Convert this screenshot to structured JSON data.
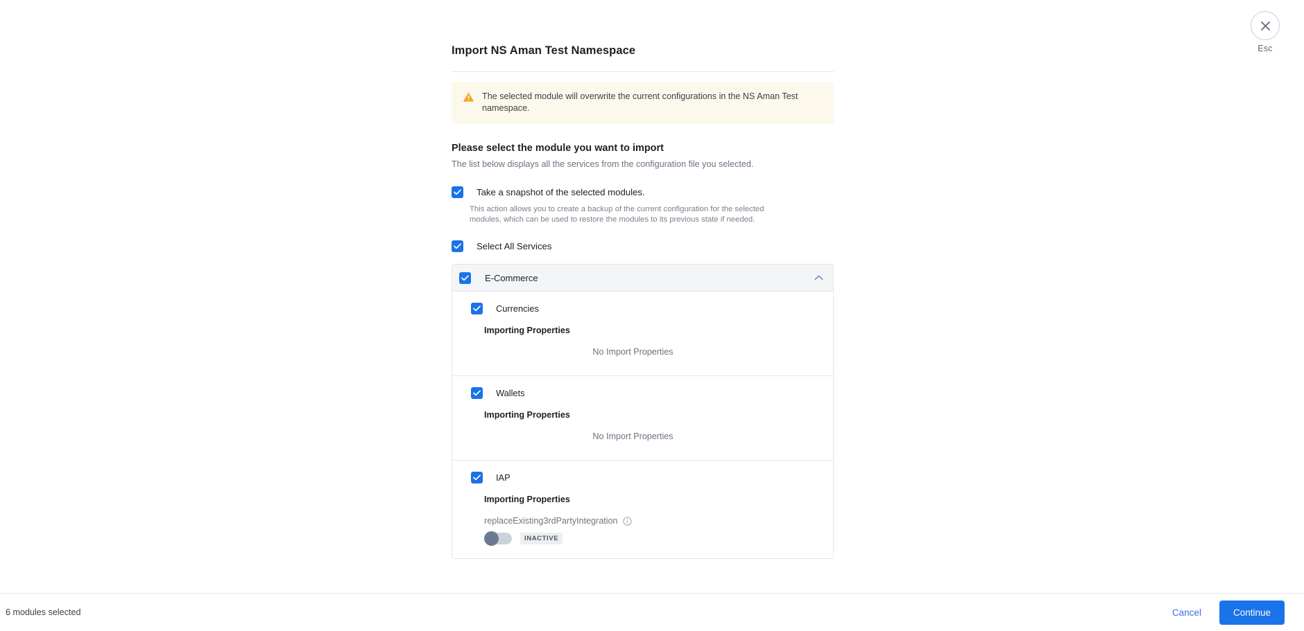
{
  "esc": {
    "label": "Esc",
    "icon": "close-icon"
  },
  "dialog": {
    "title": "Import NS Aman Test Namespace",
    "warning": {
      "icon": "warning-triangle-icon",
      "text": "The selected module will overwrite the current configurations in the NS Aman Test namespace."
    },
    "section": {
      "title": "Please select the module you want to import",
      "subtitle": "The list below displays all the services from the configuration file you selected."
    },
    "snapshot": {
      "label": "Take a snapshot of the selected modules.",
      "description": "This action allows you to create a backup of the current configuration for the selected modules, which can be used to restore the modules to its previous state if needed.",
      "checked": true
    },
    "select_all": {
      "label": "Select All Services",
      "checked": true
    },
    "module": {
      "name": "E-Commerce",
      "checked": true,
      "expanded": true,
      "chevron": "chevron-up-icon",
      "services": [
        {
          "name": "Currencies",
          "checked": true,
          "properties_title": "Importing Properties",
          "empty_text": "No Import Properties",
          "properties": []
        },
        {
          "name": "Wallets",
          "checked": true,
          "properties_title": "Importing Properties",
          "empty_text": "No Import Properties",
          "properties": []
        },
        {
          "name": "IAP",
          "checked": true,
          "properties_title": "Importing Properties",
          "empty_text": "",
          "properties": [
            {
              "name": "replaceExisting3rdPartyIntegration",
              "info_icon": "info-icon",
              "toggle_on": false,
              "status_badge": "INACTIVE"
            }
          ]
        }
      ]
    }
  },
  "footer": {
    "status": "6 modules selected",
    "cancel_label": "Cancel",
    "continue_label": "Continue"
  },
  "colors": {
    "accent": "#1a73e8",
    "warning_bg": "#fdf8ec",
    "warning_icon": "#f5a623",
    "link": "#3b6ee8",
    "muted_text": "#6b7280"
  }
}
